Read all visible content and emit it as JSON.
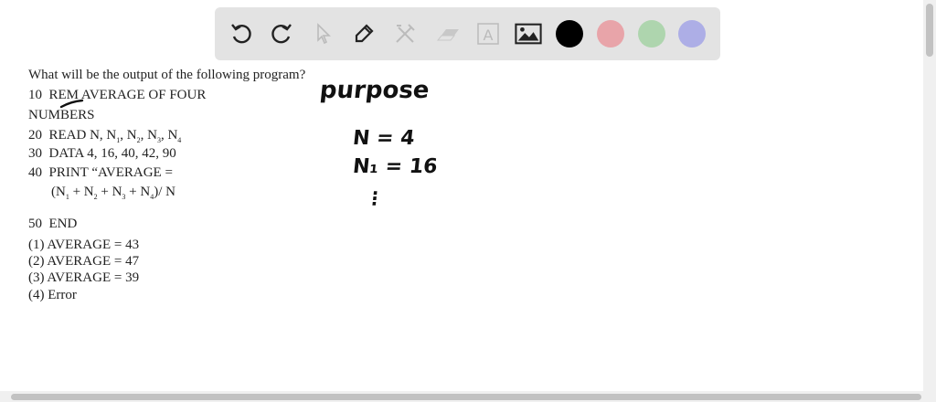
{
  "toolbar": {
    "tools": [
      "undo-icon",
      "redo-icon",
      "select-pointer-icon",
      "pen-icon",
      "tools-icon",
      "eraser-icon",
      "text-box-icon",
      "image-icon"
    ],
    "text_tool_glyph": "A",
    "colors": {
      "black": "#000000",
      "red": "#e8a4a9",
      "green": "#aed5ae",
      "blue": "#adaee6"
    }
  },
  "question": {
    "prompt": "What will be the output of the following program?",
    "lines": {
      "l10_num": "10",
      "l10_text": "REM AVERAGE OF FOUR",
      "l10_cont": "NUMBERS",
      "l20_num": "20",
      "l20_text": "READ N, N",
      "l30_num": "30",
      "l30_text": "DATA 4, 16, 40, 42, 90",
      "l40_num": "40",
      "l40_text": "PRINT “AVERAGE =",
      "l40_cont": "(N",
      "l50_num": "50",
      "l50_text": "END"
    },
    "options": [
      "(1)  AVERAGE = 43",
      "(2)  AVERAGE = 47",
      "(3)  AVERAGE = 39",
      "(4)  Error"
    ]
  },
  "handwriting": {
    "word": "purpose",
    "line1": "N = 4",
    "line2": "N₁ = 16",
    "line3": "⋮"
  }
}
